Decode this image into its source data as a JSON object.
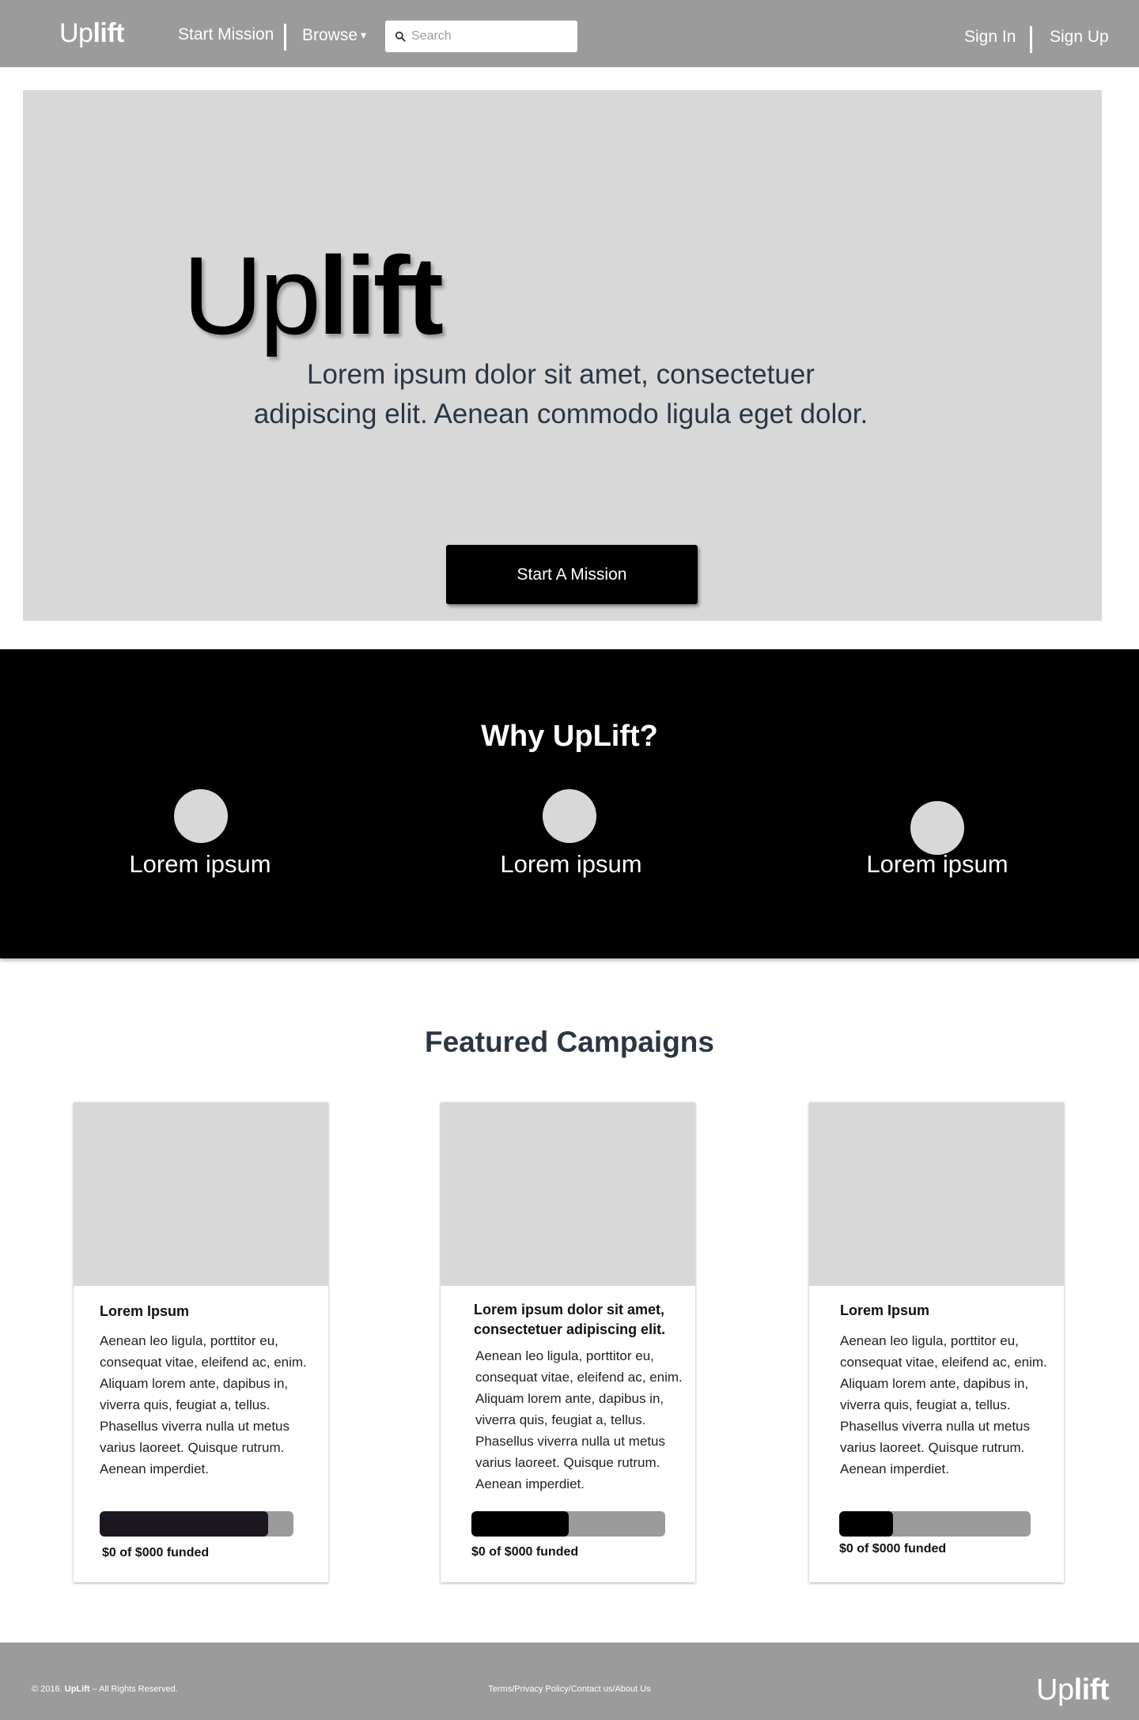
{
  "nav": {
    "logo_up": "Up",
    "logo_lift": "lift",
    "start_mission": "Start Mission",
    "browse": "Browse",
    "browse_caret": "▾",
    "search_placeholder": "Search",
    "sign_in": "Sign In",
    "sign_up": "Sign Up"
  },
  "hero": {
    "logo_up": "Up",
    "logo_lift": "lift",
    "tagline_line1": "Lorem ipsum dolor sit amet, consectetuer",
    "tagline_line2": "adipiscing elit. Aenean commodo ligula eget dolor.",
    "cta": "Start A Mission"
  },
  "why": {
    "title": "Why UpLift?",
    "items": [
      {
        "label": "Lorem ipsum"
      },
      {
        "label": "Lorem ipsum"
      },
      {
        "label": "Lorem ipsum"
      }
    ]
  },
  "featured": {
    "title": "Featured Campaigns",
    "cards": [
      {
        "title": "Lorem Ipsum",
        "body": "Aenean leo ligula, porttitor eu, consequat vitae, eleifend ac, enim. Aliquam lorem ante, dapibus in, viverra quis, feugiat a, tellus. Phasellus viverra nulla ut metus varius laoreet. Quisque rutrum. Aenean imperdiet.",
        "progress": 0.87,
        "fill_color": "#1c161f",
        "funded": "$0 of $000 funded"
      },
      {
        "title": "Lorem ipsum dolor sit amet, consectetuer adipiscing elit.",
        "body": "Aenean leo ligula, porttitor eu, consequat vitae, eleifend ac, enim. Aliquam lorem ante, dapibus in, viverra quis, feugiat a, tellus. Phasellus viverra nulla ut metus varius laoreet. Quisque rutrum. Aenean imperdiet.",
        "progress": 0.5,
        "fill_color": "#000000",
        "funded": "$0 of $000 funded"
      },
      {
        "title": "Lorem Ipsum",
        "body": "Aenean leo ligula, porttitor eu, consequat vitae, eleifend ac, enim. Aliquam lorem ante, dapibus in, viverra quis, feugiat a, tellus. Phasellus viverra nulla ut metus varius laoreet. Quisque rutrum. Aenean imperdiet.",
        "progress": 0.28,
        "fill_color": "#000000",
        "funded": "$0 of $000 funded"
      }
    ]
  },
  "footer": {
    "copyright_prefix": "© 2016.",
    "copyright_brand": "UpLift",
    "copyright_suffix": "– All Rights Reserved.",
    "links": [
      "Terms",
      "Privacy Policy",
      "Contact us",
      "About Us"
    ],
    "link_separator": "/",
    "logo_up": "Up",
    "logo_lift": "lift"
  },
  "colors": {
    "nav_bg": "#9b9b9b",
    "hero_bg": "#d8d8d8",
    "dark_text": "#2b3543",
    "why_bg": "#000000",
    "progress_track": "#9b9b9b"
  }
}
